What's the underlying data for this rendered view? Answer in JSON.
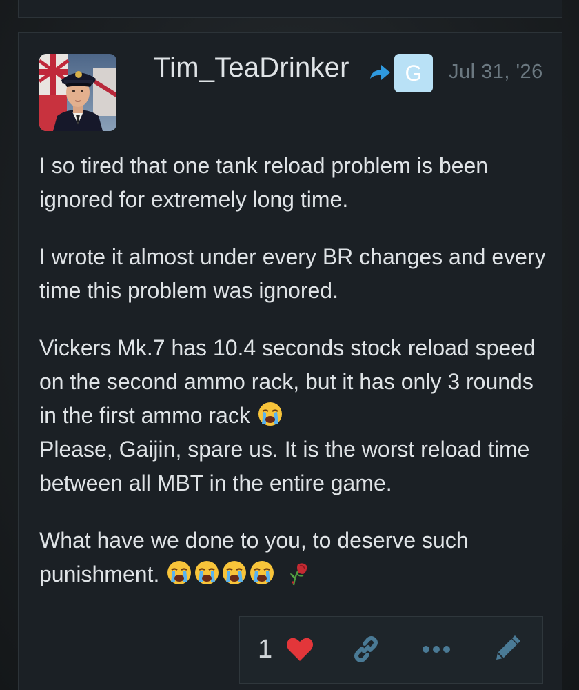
{
  "post": {
    "username": "Tim_TeaDrinker",
    "group_badge_letter": "G",
    "date": "Jul 31, '26",
    "paragraphs": [
      "I so tired that one tank reload problem is been ignored for extremely long time.",
      "I wrote it almost under every BR changes and every time this problem was ignored.",
      "Vickers Mk.7 has 10.4 seconds stock reload speed on the second ammo rack, but it has only 3 rounds in the first ammo rack",
      "Please, Gaijin, spare us. It is the worst reload time between all MBT in the entire game.",
      "What have we done to you, to deserve such punishment."
    ]
  },
  "actions": {
    "like_count": "1"
  },
  "icons": {
    "avatar": "naval-officer-avatar",
    "reply": "reply-arrow-icon",
    "heart": "heart-icon",
    "link": "link-icon",
    "more": "more-dots-icon",
    "edit": "pencil-icon",
    "emoji_cry": "loudly-crying-face-emoji",
    "emoji_rose": "wilted-rose-emoji"
  },
  "colors": {
    "background": "#1b2025",
    "text": "#dfe3e6",
    "muted": "#6b7880",
    "badge": "#b9e1f6",
    "reply_arrow": "#2f9ae0",
    "heart": "#e3363a",
    "action_icon": "#4a7a95"
  }
}
